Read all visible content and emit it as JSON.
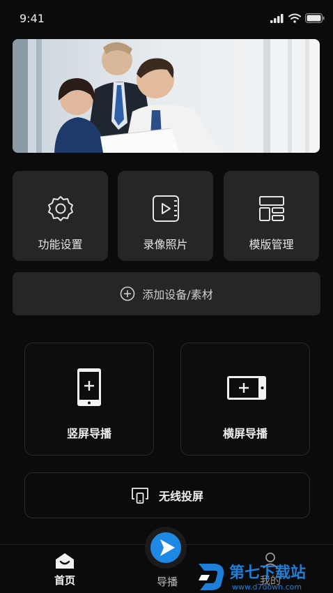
{
  "status": {
    "time": "9:41"
  },
  "tiles": [
    {
      "label": "功能设置",
      "icon": "gear-icon"
    },
    {
      "label": "录像照片",
      "icon": "video-icon"
    },
    {
      "label": "模版管理",
      "icon": "template-icon"
    }
  ],
  "add_bar": {
    "label": "添加设备/素材",
    "icon": "plus-circle-icon"
  },
  "cards": {
    "portrait": {
      "label": "竖屏导播",
      "icon": "phone-portrait-icon"
    },
    "landscape": {
      "label": "横屏导播",
      "icon": "phone-landscape-icon"
    }
  },
  "wireless": {
    "label": "无线投屏",
    "icon": "cast-icon"
  },
  "tabs": [
    {
      "label": "首页",
      "icon": "home-icon",
      "active": true
    },
    {
      "label": "导播",
      "icon": "play-icon",
      "active": false
    },
    {
      "label": "我的",
      "icon": "user-icon",
      "active": false
    }
  ],
  "watermark": {
    "brand": "第七下载站",
    "url": "www.d7down.com"
  },
  "colors": {
    "background": "#0b0b0b",
    "tile": "#262626",
    "accent": "#1e88e5"
  }
}
